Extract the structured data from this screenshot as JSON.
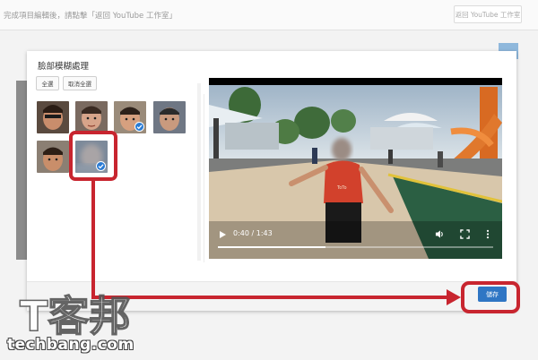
{
  "background": {
    "topbar_text": "完成項目編輯後，請點擊「返回 YouTube 工作室」",
    "topbar_button": "返回 YouTube 工作室"
  },
  "modal": {
    "title": "臉部模糊處理",
    "select_all_label": "全選",
    "deselect_all_label": "取消全選",
    "faces": [
      {
        "selected": false
      },
      {
        "selected": false
      },
      {
        "selected": true
      },
      {
        "selected": false
      },
      {
        "selected": false
      },
      {
        "selected": true
      }
    ],
    "save_label": "儲存"
  },
  "video": {
    "time": "0:40 / 1:43",
    "progress": 0.39,
    "shirt_text": "ToTo"
  },
  "watermark": {
    "logo": "T客邦",
    "domain": "techbang.com"
  },
  "colors": {
    "accent": "#2f76c4",
    "annotation": "#c8252f"
  }
}
